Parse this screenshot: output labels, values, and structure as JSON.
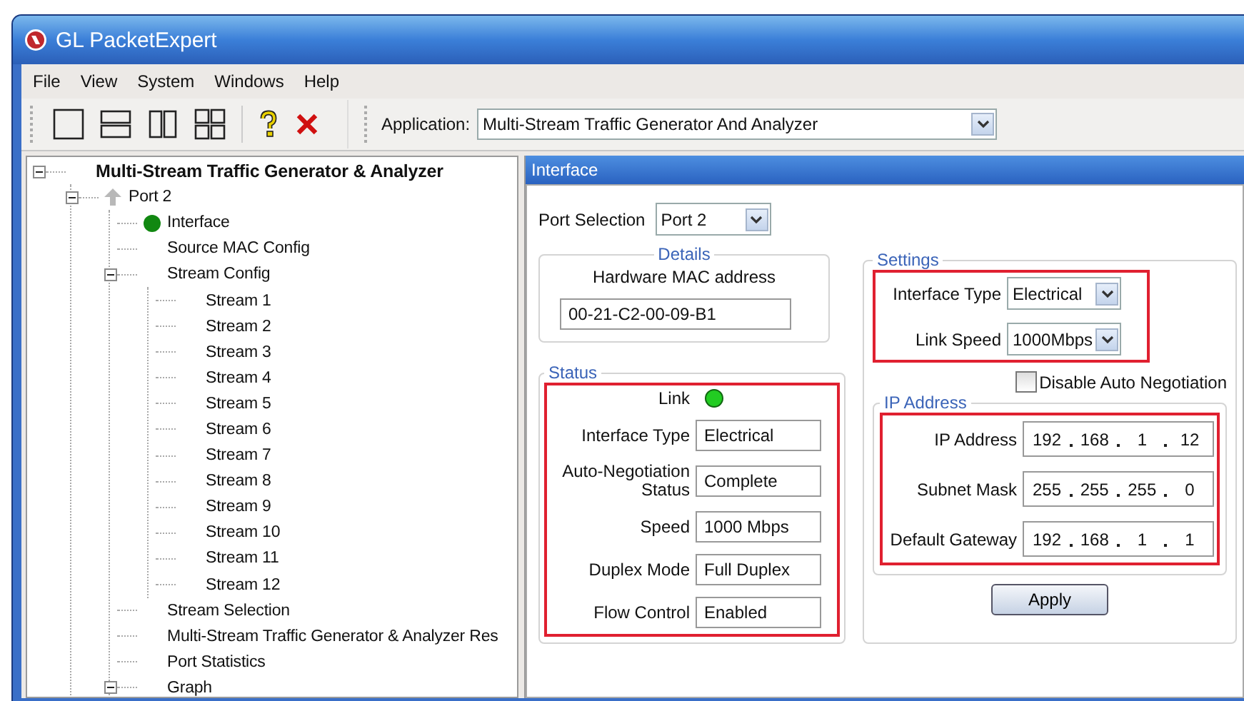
{
  "window": {
    "title": "GL PacketExpert"
  },
  "menu": [
    "File",
    "View",
    "System",
    "Windows",
    "Help"
  ],
  "toolbar": {
    "application_label": "Application:",
    "application_value": "Multi-Stream Traffic Generator And Analyzer"
  },
  "tree": {
    "label": "Multi-Stream Traffic Generator & Analyzer",
    "kind": "root",
    "expanded": true,
    "children": [
      {
        "label": "Port 2",
        "kind": "port",
        "expanded": true,
        "children": [
          {
            "label": "Interface",
            "kind": "status"
          },
          {
            "label": "Source MAC Config"
          },
          {
            "label": "Stream Config",
            "expanded": true,
            "children": [
              {
                "label": "Stream 1"
              },
              {
                "label": "Stream 2"
              },
              {
                "label": "Stream 3"
              },
              {
                "label": "Stream 4"
              },
              {
                "label": "Stream 5"
              },
              {
                "label": "Stream 6"
              },
              {
                "label": "Stream 7"
              },
              {
                "label": "Stream 8"
              },
              {
                "label": "Stream 9"
              },
              {
                "label": "Stream 10"
              },
              {
                "label": "Stream 11"
              },
              {
                "label": "Stream 12"
              }
            ]
          },
          {
            "label": "Stream Selection"
          },
          {
            "label": "Multi-Stream Traffic Generator & Analyzer Res"
          },
          {
            "label": "Port Statistics"
          },
          {
            "label": "Graph",
            "expanded": true
          }
        ]
      }
    ]
  },
  "panel": {
    "title": "Interface",
    "port_selection": {
      "label": "Port Selection",
      "value": "Port 2"
    },
    "details": {
      "title": "Details",
      "label": "Hardware MAC address",
      "value": "00-21-C2-00-09-B1"
    },
    "status": {
      "title": "Status",
      "highlighted": true,
      "link_label": "Link",
      "link_on": true,
      "fields": [
        {
          "label": "Interface Type",
          "value": "Electrical"
        },
        {
          "label": "Auto-Negotiation Status",
          "value": "Complete"
        },
        {
          "label": "Speed",
          "value": "1000 Mbps"
        },
        {
          "label": "Duplex Mode",
          "value": "Full Duplex"
        },
        {
          "label": "Flow Control",
          "value": "Enabled"
        }
      ]
    },
    "settings": {
      "title": "Settings",
      "highlighted": true,
      "fields": [
        {
          "label": "Interface Type",
          "value": "Electrical"
        },
        {
          "label": "Link Speed",
          "value": "1000Mbps"
        }
      ],
      "disable_auto_negotiation": {
        "label": "Disable Auto Negotiation",
        "checked": false
      }
    },
    "ip_address": {
      "title": "IP Address",
      "highlighted": true,
      "fields": [
        {
          "label": "IP Address",
          "octets": [
            "192",
            "168",
            "1",
            "12"
          ]
        },
        {
          "label": "Subnet Mask",
          "octets": [
            "255",
            "255",
            "255",
            "0"
          ]
        },
        {
          "label": "Default Gateway",
          "octets": [
            "192",
            "168",
            "1",
            "1"
          ]
        }
      ]
    },
    "apply_button": "Apply"
  }
}
